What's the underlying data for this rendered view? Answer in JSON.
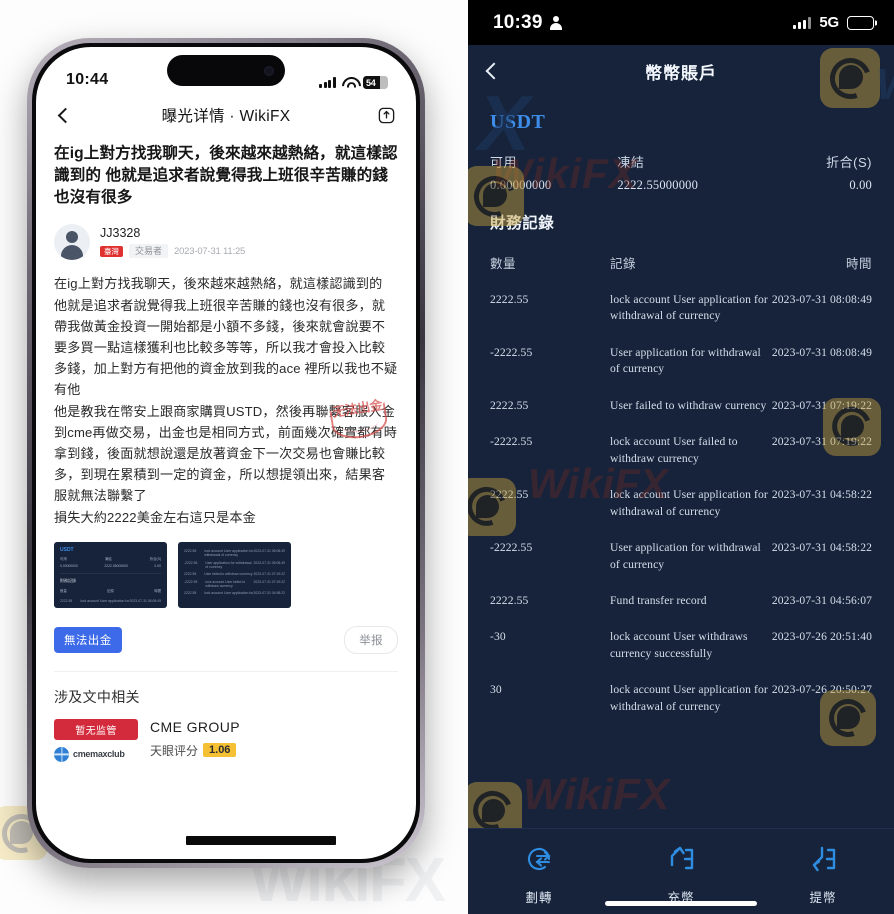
{
  "left": {
    "status_bar": {
      "time": "10:44",
      "battery_level": "54"
    },
    "nav": {
      "title": "曝光详情 · WikiFX",
      "back_icon": "chevron-left-icon",
      "share_icon": "share-icon"
    },
    "article": {
      "headline": "在ig上對方找我聊天，後來越來越熱絡，就這樣認識到的 他就是追求者說覺得我上班很辛苦賺的錢也沒有很多",
      "author": "JJ3328",
      "flag_badge": "臺灣",
      "role_badge": "交易者",
      "timestamp": "2023-07-31 11:25",
      "body": "在ig上對方找我聊天，後來越來越熱絡，就這樣認識到的\n他就是追求者說覺得我上班很辛苦賺的錢也沒有很多，就帶我做黃金投資一開始都是小額不多錢，後來就會說要不要多買一點這樣獲利也比較多等等，所以我才會投入比較多錢，加上對方有把他的資金放到我的ace 裡所以我也不疑有他\n他是教我在幣安上跟商家購買USTD，然後再聯繫客服入金到cme再做交易，出金也是相同方式，前面幾次確實都有時拿到錢，後面就想說還是放著資金下一次交易也會賺比較多，到現在累積到一定的資金，所以想提領出來，結果客服就無法聯繫了\n損失大約2222美金左右這只是本金",
      "stamp_text": "无法出金"
    },
    "thumbnails": [
      {
        "symbol": "USDT",
        "labels": [
          "可用",
          "凍結",
          "折合(S)"
        ],
        "values": [
          "0.00000000",
          "2222.55000000",
          "0.00"
        ],
        "section": "財務記錄",
        "columns": [
          "數量",
          "記錄",
          "時間"
        ],
        "row": [
          "2222.55",
          "lock account User application for",
          "2023-07-31 08:08:49"
        ]
      },
      {
        "rows": [
          {
            "amount": "2222.55",
            "record": "lock account User application for withdrawal of currency",
            "time": "2023-07-31 08:08:49"
          },
          {
            "amount": "-2222.55",
            "record": "User application for withdrawal of currency",
            "time": "2023-07-31 08:08:49"
          },
          {
            "amount": "2222.55",
            "record": "User failed to withdraw currency",
            "time": "2023-07-31 07:19:22"
          },
          {
            "amount": "-2222.55",
            "record": "lock account User failed to withdraw currency",
            "time": "2023-07-31 07:19:22"
          },
          {
            "amount": "2222.55",
            "record": "lock account User application for",
            "time": "2023-07-31 04:58:22"
          }
        ]
      }
    ],
    "tag_label": "無法出金",
    "report_label": "举报",
    "related_section_title": "涉及文中相关",
    "broker": {
      "regulation_badge": "暂无监管",
      "logo_text": "cmemaxclub",
      "name": "CME GROUP",
      "score_label": "天眼评分",
      "score_value": "1.06"
    }
  },
  "right": {
    "status_bar": {
      "time": "10:39",
      "network": "5G"
    },
    "nav": {
      "title": "幣幣賬戶",
      "back_icon": "chevron-left-icon"
    },
    "balance": {
      "symbol": "USDT",
      "available_label": "可用",
      "available_value": "0.00000000",
      "frozen_label": "凍結",
      "frozen_value": "2222.55000000",
      "converted_label": "折合(S)",
      "converted_value": "0.00"
    },
    "records": {
      "title": "財務記錄",
      "columns": {
        "amount": "數量",
        "record": "記錄",
        "time": "時間"
      },
      "rows": [
        {
          "amount": "2222.55",
          "record": "lock account User application for withdrawal of currency",
          "time": "2023-07-31 08:08:49"
        },
        {
          "amount": "-2222.55",
          "record": "User application for withdrawal of currency",
          "time": "2023-07-31 08:08:49"
        },
        {
          "amount": "2222.55",
          "record": "User failed to withdraw currency",
          "time": "2023-07-31 07:19:22"
        },
        {
          "amount": "-2222.55",
          "record": "lock account User failed to withdraw currency",
          "time": "2023-07-31 07:19:22"
        },
        {
          "amount": "2222.55",
          "record": "lock account User application for withdrawal of currency",
          "time": "2023-07-31 04:58:22"
        },
        {
          "amount": "-2222.55",
          "record": "User application for withdrawal of currency",
          "time": "2023-07-31 04:58:22"
        },
        {
          "amount": "2222.55",
          "record": "Fund transfer record",
          "time": "2023-07-31 04:56:07"
        },
        {
          "amount": "-30",
          "record": "lock account User withdraws currency successfully",
          "time": "2023-07-26 20:51:40"
        },
        {
          "amount": "30",
          "record": "lock account User application for withdrawal of currency",
          "time": "2023-07-26 20:50:27"
        }
      ]
    },
    "bottom_nav": [
      {
        "label": "劃轉",
        "icon": "transfer-icon"
      },
      {
        "label": "充幣",
        "icon": "deposit-icon"
      },
      {
        "label": "提幣",
        "icon": "withdraw-icon"
      }
    ]
  },
  "watermark": {
    "brand": "WikiFX"
  },
  "colors": {
    "accent_blue": "#3c6ae8",
    "symbol_blue": "#3d8ce8",
    "dark_bg": "#16233a",
    "badge_red": "#d42b3c",
    "score_yellow": "#f5c034"
  }
}
